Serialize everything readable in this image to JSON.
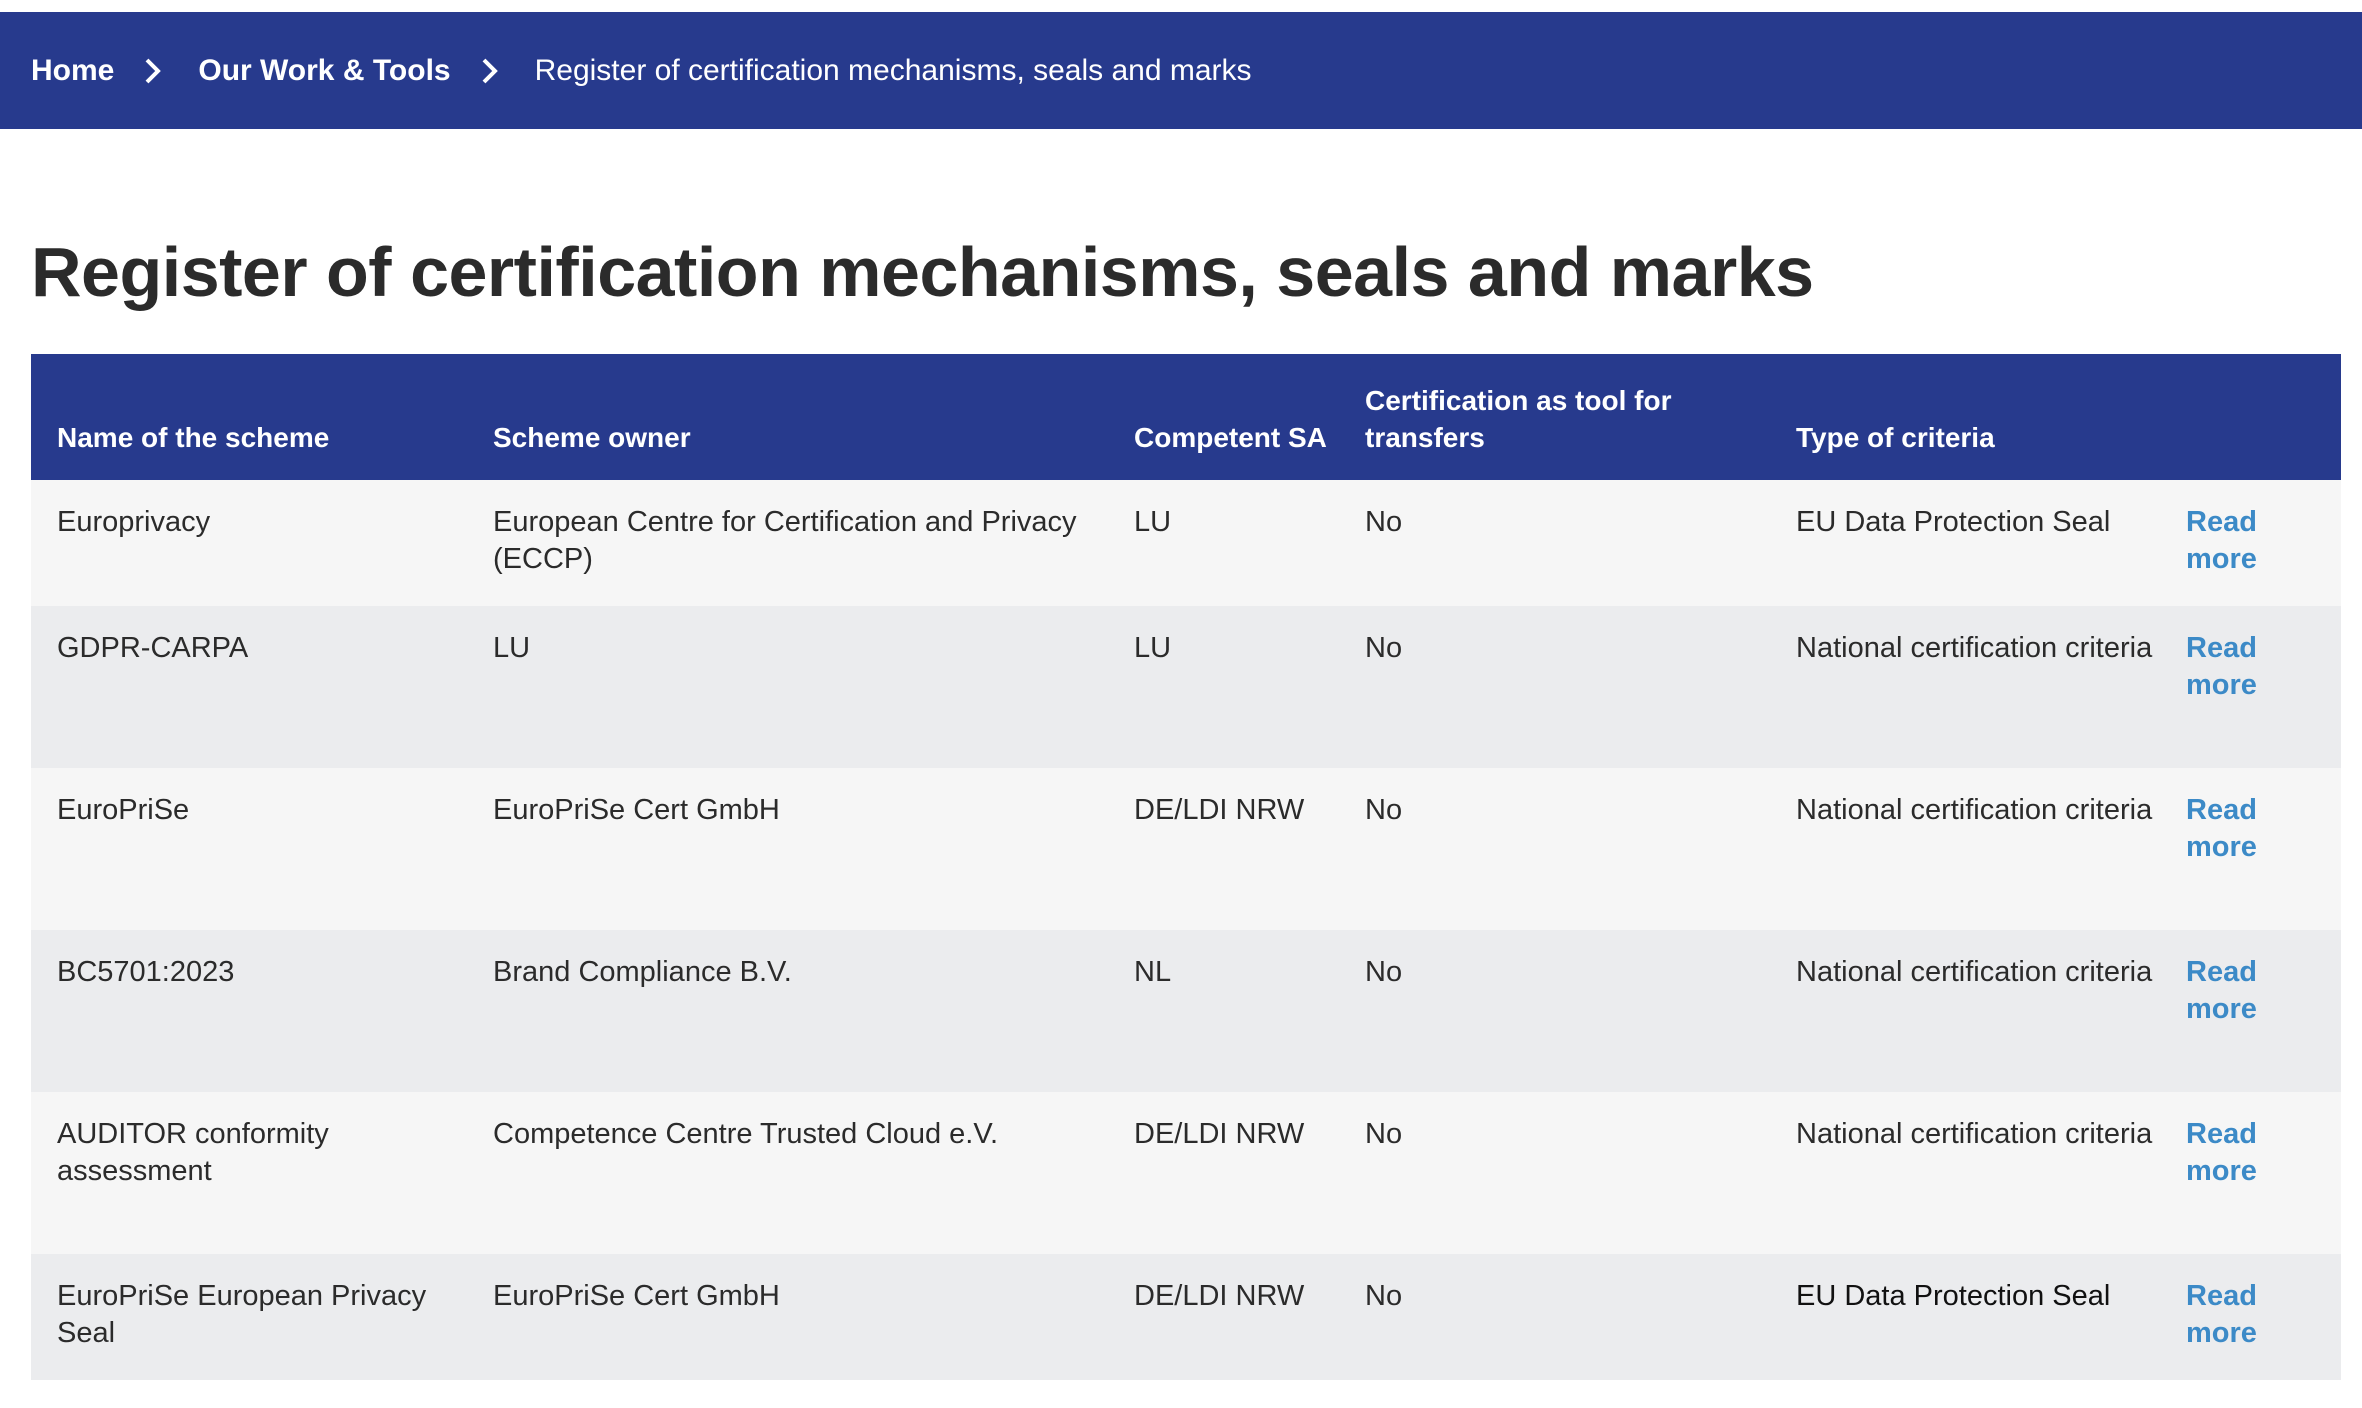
{
  "breadcrumb": {
    "home": "Home",
    "section": "Our Work & Tools",
    "current": "Register of certification mechanisms, seals and marks"
  },
  "page_title": "Register of certification mechanisms, seals and marks",
  "table": {
    "headers": {
      "name": "Name of the scheme",
      "owner": "Scheme owner",
      "sa": "Competent SA",
      "transfers": "Certification as tool for transfers",
      "criteria": "Type of criteria"
    },
    "rows": [
      {
        "name": "Europrivacy",
        "owner": "European Centre for Certification and Privacy (ECCP)",
        "sa": "LU",
        "transfers": "No",
        "criteria": "EU Data Protection Seal",
        "link": "Read more"
      },
      {
        "name": "GDPR-CARPA",
        "owner": "LU",
        "sa": "LU",
        "transfers": "No",
        "criteria": "National certification criteria",
        "link": "Read more"
      },
      {
        "name": "EuroPriSe",
        "owner": "EuroPriSe Cert GmbH",
        "sa": "DE/LDI NRW",
        "transfers": "No",
        "criteria": "National certification criteria",
        "link": "Read more"
      },
      {
        "name": "BC5701:2023",
        "owner": "Brand Compliance B.V.",
        "sa": "NL",
        "transfers": "No",
        "criteria": "National certification criteria",
        "link": "Read more"
      },
      {
        "name": "AUDITOR conformity assessment",
        "owner": "Competence Centre Trusted Cloud e.V.",
        "sa": "DE/LDI NRW",
        "transfers": "No",
        "criteria": "National certification criteria",
        "link": "Read more"
      },
      {
        "name": "EuroPriSe European Privacy Seal",
        "owner": "EuroPriSe Cert GmbH",
        "sa": "DE/LDI NRW",
        "transfers": "No",
        "criteria": "EU Data Protection Seal",
        "link": "Read more"
      }
    ]
  },
  "colors": {
    "brand_navy": "#273a8d",
    "link_blue": "#3c8ac7",
    "row_light": "#f6f6f6",
    "row_dark": "#ebecee"
  },
  "icons": [
    "chevron-right-icon"
  ]
}
